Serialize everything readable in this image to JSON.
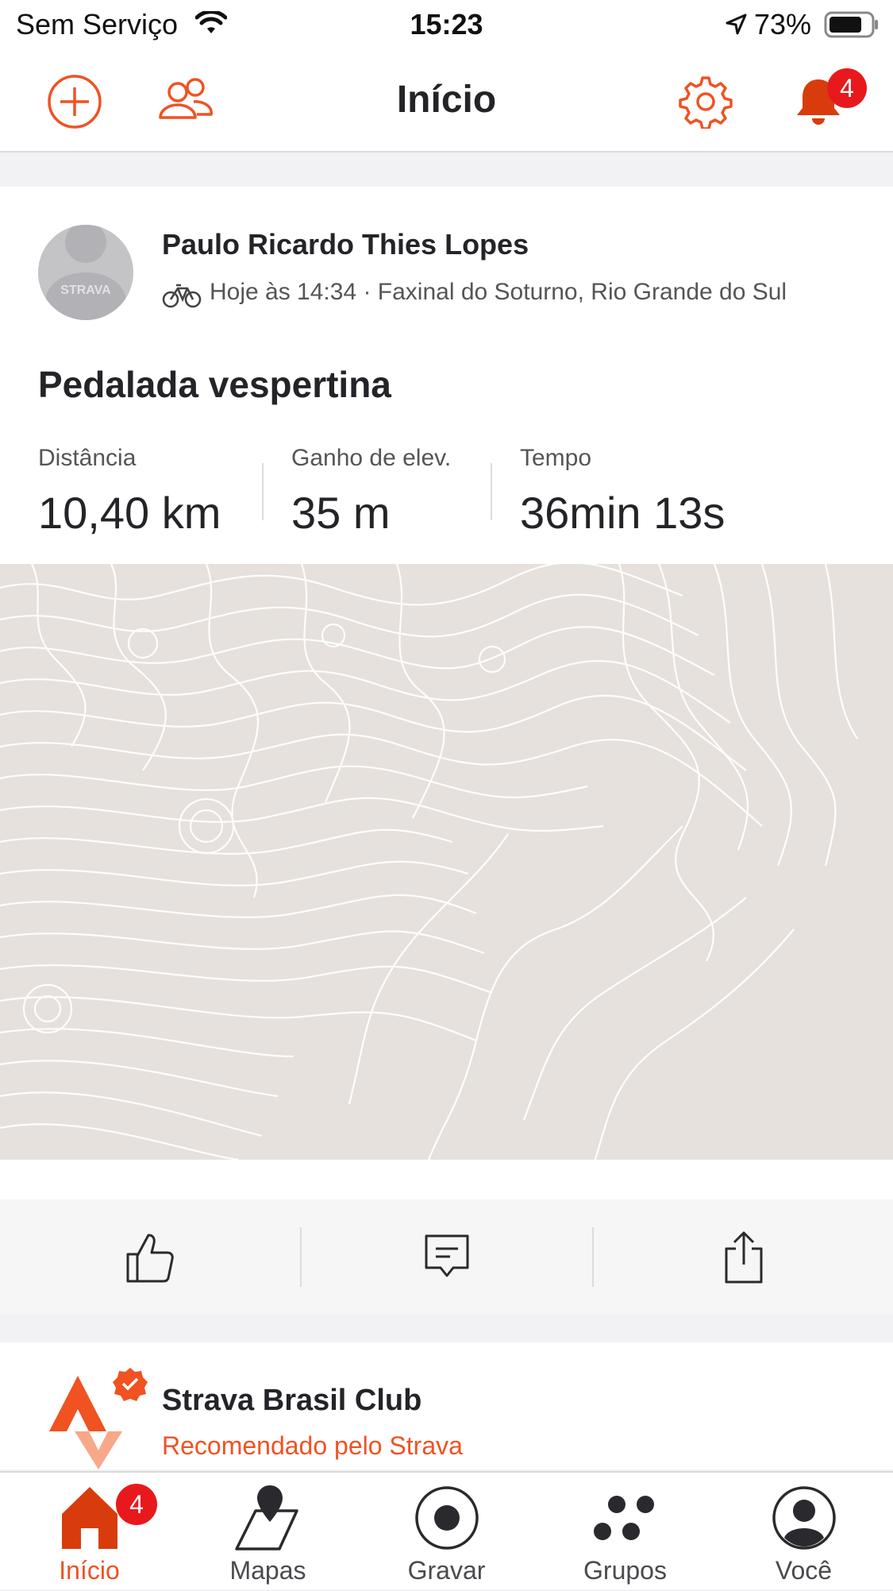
{
  "status_bar": {
    "carrier": "Sem Serviço",
    "time": "15:23",
    "battery": "73%"
  },
  "header": {
    "title": "Início",
    "notification_count": "4",
    "icons": [
      "add-circle-icon",
      "people-icon",
      "gear-icon",
      "bell-icon"
    ]
  },
  "activity": {
    "athlete_name": "Paulo Ricardo Thies Lopes",
    "avatar_text": "STRAVA",
    "meta": "Hoje às 14:34 · Faxinal do Soturno, Rio Grande do Sul",
    "title": "Pedalada vespertina",
    "stats": [
      {
        "label": "Distância",
        "value": "10,40 km"
      },
      {
        "label": "Ganho de elev.",
        "value": "35 m"
      },
      {
        "label": "Tempo",
        "value": "36min 13s"
      }
    ]
  },
  "actions": [
    "thumbs-up-icon",
    "comment-icon",
    "share-icon"
  ],
  "club": {
    "name": "Strava Brasil Club",
    "subtitle": "Recomendado pelo Strava"
  },
  "tabbar": {
    "items": [
      {
        "label": "Início",
        "icon": "home-icon",
        "active": true,
        "badge": "4"
      },
      {
        "label": "Mapas",
        "icon": "map-icon"
      },
      {
        "label": "Gravar",
        "icon": "record-icon"
      },
      {
        "label": "Grupos",
        "icon": "groups-icon"
      },
      {
        "label": "Você",
        "icon": "profile-icon"
      }
    ]
  },
  "colors": {
    "accent": "#f05222",
    "badge": "#e8191d",
    "map_bg": "#e6e1dd"
  }
}
